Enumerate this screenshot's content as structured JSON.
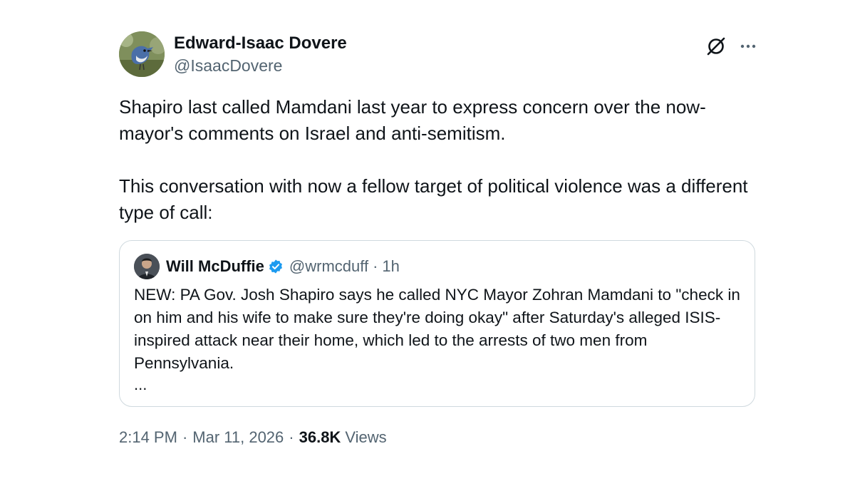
{
  "author": {
    "display_name": "Edward-Isaac Dovere",
    "handle": "@IsaacDovere"
  },
  "icons": {
    "grok": "grok-icon",
    "more": "more-options-icon",
    "verified": "verified-badge-icon"
  },
  "tweet": {
    "paragraphs": [
      "Shapiro last called Mamdani last year to express concern over the now-mayor's comments on Israel and anti-semitism.",
      "This conversation with now a fellow target of political violence was a different type of call:"
    ]
  },
  "quote": {
    "display_name": "Will McDuffie",
    "handle": "@wrmcduff",
    "separator": "·",
    "time": "1h",
    "text": "NEW: PA Gov. Josh Shapiro says he called NYC Mayor Zohran Mamdani to \"check in on him and his wife to make sure they're doing okay\" after Saturday's alleged ISIS-inspired attack near their home, which led to the arrests of two men from Pennsylvania.",
    "ellipsis": "..."
  },
  "meta": {
    "time": "2:14 PM",
    "separator": "·",
    "date": "Mar 11, 2026",
    "views_count": "36.8K",
    "views_label": "Views"
  },
  "colors": {
    "text_primary": "#0f1419",
    "text_secondary": "#536471",
    "border": "#cfd9de",
    "verified_blue": "#1d9bf0"
  }
}
